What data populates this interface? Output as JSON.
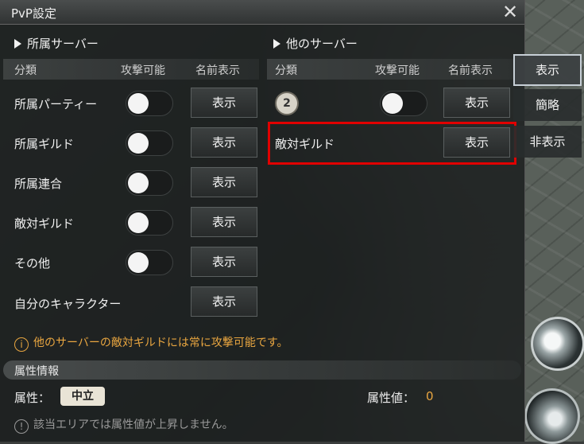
{
  "window": {
    "title": "PvP設定"
  },
  "own_server": {
    "heading": "所属サーバー",
    "col_category": "分類",
    "col_attack": "攻撃可能",
    "col_name": "名前表示",
    "rows": [
      {
        "label": "所属パーティー",
        "has_toggle": true,
        "toggle_on": false,
        "button": "表示"
      },
      {
        "label": "所属ギルド",
        "has_toggle": true,
        "toggle_on": false,
        "button": "表示"
      },
      {
        "label": "所属連合",
        "has_toggle": true,
        "toggle_on": false,
        "button": "表示"
      },
      {
        "label": "敵対ギルド",
        "has_toggle": true,
        "toggle_on": false,
        "button": "表示"
      },
      {
        "label": "その他",
        "has_toggle": true,
        "toggle_on": false,
        "button": "表示"
      },
      {
        "label": "自分のキャラクター",
        "has_toggle": false,
        "button": "表示"
      }
    ]
  },
  "other_server": {
    "heading": "他のサーバー",
    "col_category": "分類",
    "col_attack": "攻撃可能",
    "col_name": "名前表示",
    "badge": "2",
    "row1_button": "表示",
    "row2_label": "敵対ギルド",
    "row2_button": "表示"
  },
  "dropdown": {
    "options": [
      "表示",
      "簡略",
      "非表示"
    ],
    "selected": "表示"
  },
  "info_text": "他のサーバーの敵対ギルドには常に攻撃可能です。",
  "attribute": {
    "section_title": "属性情報",
    "label": "属性：",
    "value": "中立",
    "value_label": "属性値：",
    "points": "0",
    "note": "該当エリアでは属性値が上昇しません。"
  },
  "colors": {
    "accent_orange": "#e9a640",
    "highlight_red": "#e10000"
  },
  "icons": {
    "close": "close-icon",
    "info": "info-icon"
  }
}
